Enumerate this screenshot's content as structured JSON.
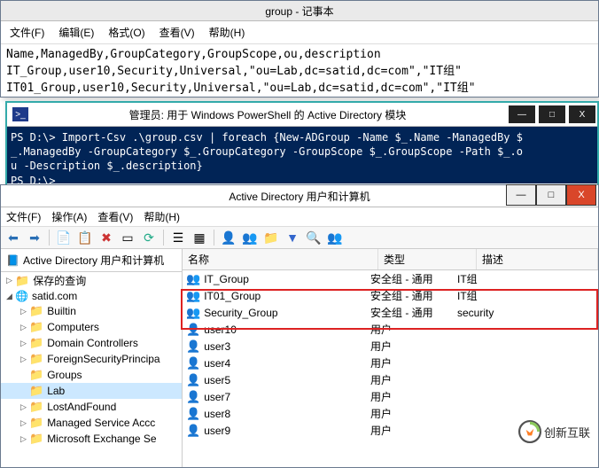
{
  "notepad": {
    "title": "group - 记事本",
    "menu": [
      "文件(F)",
      "编辑(E)",
      "格式(O)",
      "查看(V)",
      "帮助(H)"
    ],
    "lines": [
      "Name,ManagedBy,GroupCategory,GroupScope,ou,description",
      "IT_Group,user10,Security,Universal,\"ou=Lab,dc=satid,dc=com\",\"IT组\"",
      "IT01_Group,user10,Security,Universal,\"ou=Lab,dc=satid,dc=com\",\"IT组\""
    ]
  },
  "powershell": {
    "title": "管理员: 用于 Windows PowerShell 的 Active Directory 模块",
    "lines": [
      "PS D:\\> Import-Csv .\\group.csv | foreach {New-ADGroup -Name $_.Name -ManagedBy $",
      "_.ManagedBy -GroupCategory $_.GroupCategory -GroupScope $_.GroupScope -Path $_.o",
      "u -Description $_.description}",
      "PS D:\\>"
    ]
  },
  "ad": {
    "title": "Active Directory 用户和计算机",
    "menu": [
      "文件(F)",
      "操作(A)",
      "查看(V)",
      "帮助(H)"
    ],
    "tree_root": "Active Directory 用户和计算机",
    "tree": {
      "saved_queries": "保存的查询",
      "domain": "satid.com",
      "builtin": "Builtin",
      "computers": "Computers",
      "domain_controllers": "Domain Controllers",
      "fsp": "ForeignSecurityPrincipa",
      "groups": "Groups",
      "lab": "Lab",
      "laf": "LostAndFound",
      "msa": "Managed Service Accc",
      "mes": "Microsoft Exchange Se"
    },
    "cols": {
      "name": "名称",
      "type": "类型",
      "desc": "描述"
    },
    "rows": [
      {
        "icon": "group",
        "name": "IT_Group",
        "type": "安全组 - 通用",
        "desc": "IT组"
      },
      {
        "icon": "group",
        "name": "IT01_Group",
        "type": "安全组 - 通用",
        "desc": "IT组"
      },
      {
        "icon": "group",
        "name": "Security_Group",
        "type": "安全组 - 通用",
        "desc": "security"
      },
      {
        "icon": "user",
        "name": "user10",
        "type": "用户",
        "desc": ""
      },
      {
        "icon": "user",
        "name": "user3",
        "type": "用户",
        "desc": ""
      },
      {
        "icon": "user",
        "name": "user4",
        "type": "用户",
        "desc": ""
      },
      {
        "icon": "user",
        "name": "user5",
        "type": "用户",
        "desc": ""
      },
      {
        "icon": "user",
        "name": "user7",
        "type": "用户",
        "desc": ""
      },
      {
        "icon": "user",
        "name": "user8",
        "type": "用户",
        "desc": ""
      },
      {
        "icon": "user",
        "name": "user9",
        "type": "用户",
        "desc": ""
      }
    ]
  },
  "watermark": "创新互联"
}
